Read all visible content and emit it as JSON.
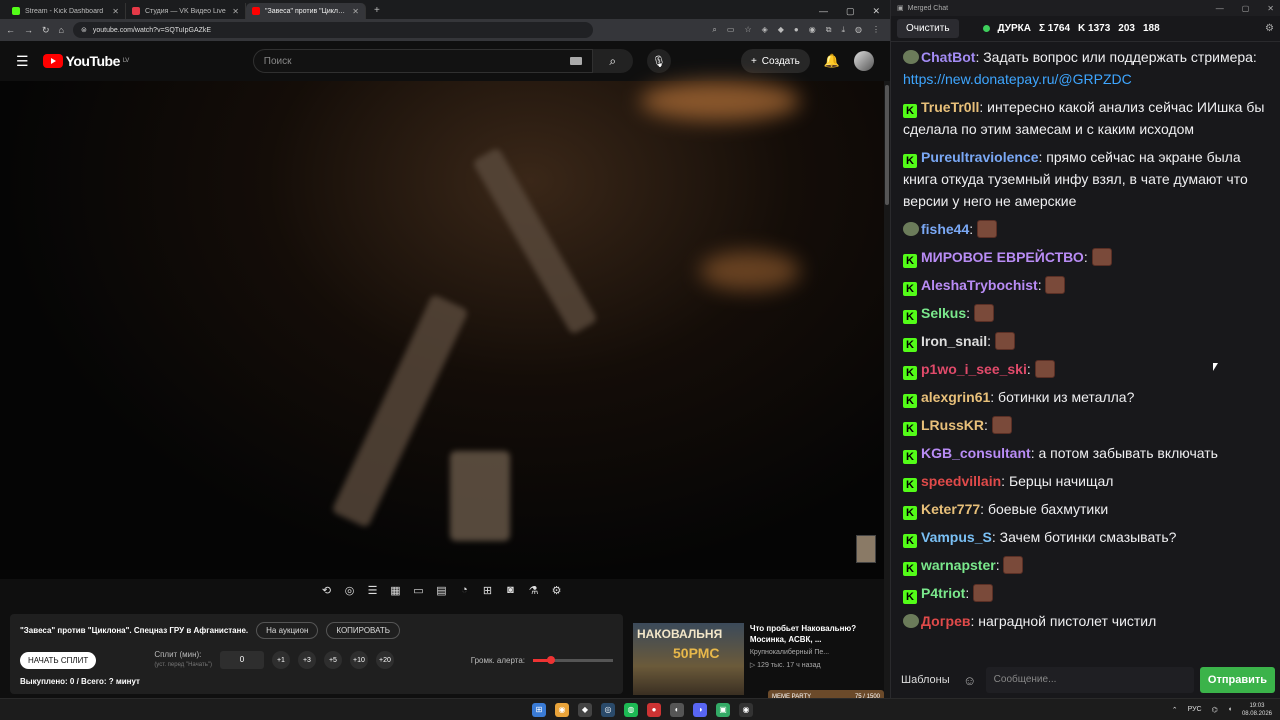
{
  "browser": {
    "tabs": [
      {
        "title": "Stream - Kick Dashboard",
        "color": "#53fc18"
      },
      {
        "title": "Студия — VK Видео Live",
        "color": "#e53947"
      },
      {
        "title": "\"Завеса\" против \"Циклона\"",
        "color": "#ff0000"
      }
    ],
    "url": "youtube.com/watch?v=SQTuIpGAZkE"
  },
  "youtube": {
    "region": "LV",
    "logo": "YouTube",
    "search_placeholder": "Поиск",
    "create_label": "Создать"
  },
  "panel": {
    "video_title": "\"Завеса\" против \"Циклона\". Спецназ ГРУ в Афганистане.",
    "auction_label": "На аукцион",
    "copy_label": "КОПИРОВАТЬ",
    "start_split_label": "НАЧАТЬ СПЛИТ",
    "split_label": "Сплит (мин):",
    "split_hint": "(уст. перед \"Начать\")",
    "split_value": "0",
    "increments": [
      "+1",
      "+3",
      "+5",
      "+10",
      "+20"
    ],
    "alert_volume_label": "Громк. алерта:",
    "alert_volume": 0.23,
    "bought_text": "Выкуплено: 0 / Всего: ? минут"
  },
  "recommended": {
    "thumb_line1": "НАКОВАЛЬНЯ",
    "thumb_line2": "50РМС",
    "title": "Что пробьет Наковальню? Мосинка, АСВК, ...",
    "channel": "Крупнокалиберный Пе...",
    "meta": "▷ 129 тыс.  17 ч назад"
  },
  "overlay": {
    "label": "MEME PARTY",
    "counter": "75 / 1500"
  },
  "chat": {
    "window_title": "Merged Chat",
    "clear_label": "Очистить",
    "channel": "ДУРКА",
    "stats": [
      "Σ 1764",
      "K 1373",
      "203",
      "188"
    ],
    "messages": [
      {
        "platform": "vk",
        "user": "ChatBot",
        "color": "#a48cf5",
        "text": "Задать вопрос или поддержать стримера: ",
        "link": "https://new.donatepay.ru/@GRPZDC"
      },
      {
        "platform": "kick",
        "user": "TrueTr0ll",
        "color": "#e8c07a",
        "text": "интересно какой анализ сейчас ИИшка бы сделала по этим замесам и с каким исходом"
      },
      {
        "platform": "kick",
        "user": "Pureultraviolence",
        "color": "#7aa8f5",
        "text": "прямо сейчас на экране была книга откуда туземный инфу взял, в чате думают что версии у него не амерские"
      },
      {
        "platform": "vk",
        "user": "fishe44",
        "color": "#7aa8f5",
        "text": ""
      },
      {
        "platform": "kick",
        "user": "МИРОВОЕ ЕВРЕЙСТВО",
        "color": "#b98cf5",
        "text": ""
      },
      {
        "platform": "kick",
        "user": "AleshaTrybochist",
        "color": "#b98cf5",
        "text": ""
      },
      {
        "platform": "kick",
        "user": "Selkus",
        "color": "#7ae88c",
        "text": ""
      },
      {
        "platform": "kick",
        "user": "Iron_snail",
        "color": "#dddddd",
        "text": ""
      },
      {
        "platform": "kick",
        "user": "p1wo_i_see_ski",
        "color": "#e04a6a",
        "text": ""
      },
      {
        "platform": "kick",
        "user": "alexgrin61",
        "color": "#e8c07a",
        "text": "ботинки из металла?"
      },
      {
        "platform": "kick",
        "user": "LRussKR",
        "color": "#e8c07a",
        "text": ""
      },
      {
        "platform": "kick",
        "user": "KGB_consultant",
        "color": "#b98cf5",
        "text": "а потом забывать включать"
      },
      {
        "platform": "kick",
        "user": "speedvillain",
        "color": "#e04a4a",
        "text": "Берцы начищал"
      },
      {
        "platform": "kick",
        "user": "Keter777",
        "color": "#e8c07a",
        "text": "боевые бахмутики"
      },
      {
        "platform": "kick",
        "user": "Vampus_S",
        "color": "#7ac0f5",
        "text": "Зачем ботинки смазывать?"
      },
      {
        "platform": "kick",
        "user": "warnapster",
        "color": "#7ae88c",
        "text": ""
      },
      {
        "platform": "kick",
        "user": "P4triot",
        "color": "#7ae88c",
        "text": ""
      },
      {
        "platform": "vk",
        "user": "Догрев",
        "color": "#e04a4a",
        "text": "наградной пистолет чистил"
      }
    ],
    "templates_label": "Шаблоны",
    "input_placeholder": "Сообщение...",
    "send_label": "Отправить"
  },
  "taskbar": {
    "lang": "РУС",
    "time": "19:03",
    "date": "08.08.2026"
  }
}
